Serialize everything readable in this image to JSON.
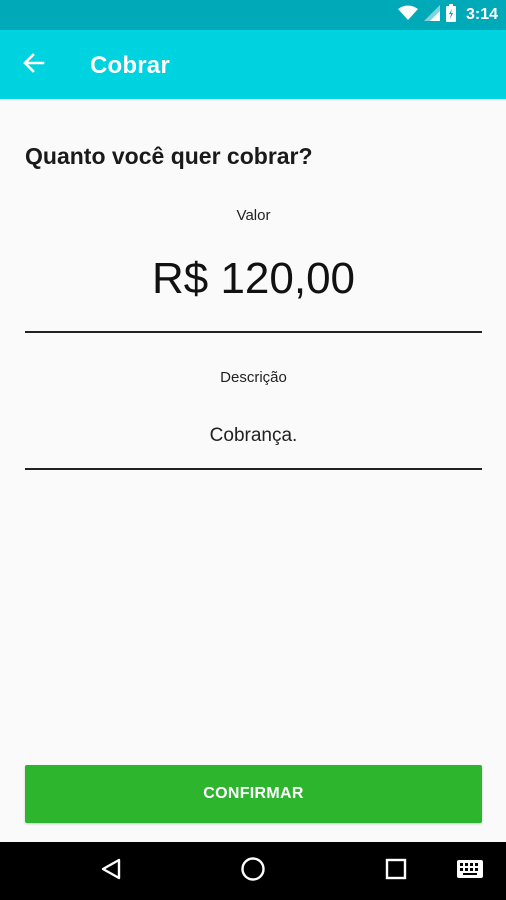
{
  "status_bar": {
    "time": "3:14",
    "icons": [
      "wifi-icon",
      "signal-icon",
      "battery-icon"
    ]
  },
  "app_bar": {
    "title": "Cobrar",
    "back_icon": "arrow-left-icon"
  },
  "main": {
    "question": "Quanto você quer cobrar?",
    "valor_label": "Valor",
    "valor_value": "R$ 120,00",
    "descricao_label": "Descrição",
    "descricao_value": "Cobrança."
  },
  "confirm_button": {
    "label": "CONFIRMAR"
  },
  "nav_bar": {
    "icons": [
      "back-triangle-icon",
      "home-circle-icon",
      "recents-square-icon",
      "keyboard-icon"
    ]
  },
  "colors": {
    "status_bar": "#00a9b8",
    "app_bar": "#00d3e0",
    "button": "#2db52d",
    "background": "#fafafa"
  }
}
